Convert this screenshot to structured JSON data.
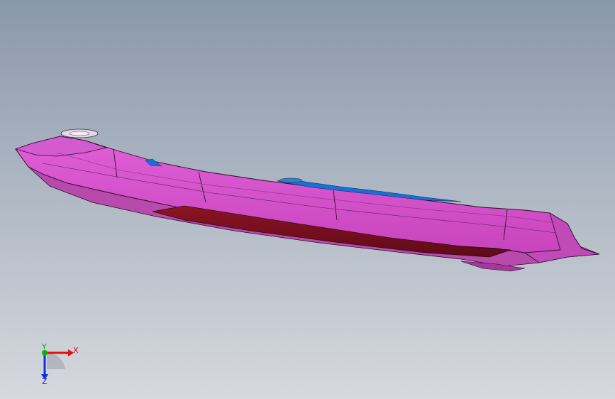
{
  "viewport": {
    "background_top": "#8a98ab",
    "background_bottom": "#d6d9de"
  },
  "model": {
    "hull_color": "#d94fc9",
    "hull_shadow_color": "#b03aa2",
    "hull_under_color": "#c14ab3",
    "stripe_color": "#7a1020",
    "deck_accent_color": "#1a6fd6",
    "edge_color": "#1a0a1a"
  },
  "triad": {
    "x_label": "X",
    "y_label": "Y",
    "z_label": "Z",
    "x_color": "#e01010",
    "y_color": "#10b010",
    "z_color": "#1030e0"
  }
}
